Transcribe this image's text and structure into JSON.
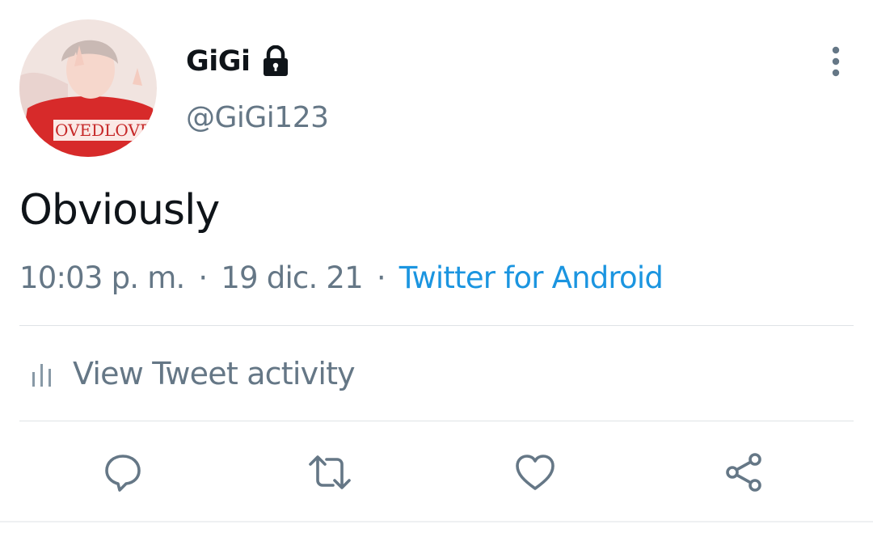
{
  "user": {
    "display_name": "GiGi",
    "handle": "@GiGi123",
    "avatar_shirt_text": "OVEDLOVE"
  },
  "tweet": {
    "text": "Obviously",
    "time": "10:03 p. m.",
    "date": "19 dic. 21",
    "separator": "·",
    "source": "Twitter for Android"
  },
  "activity": {
    "label": "View Tweet activity"
  },
  "icons": {
    "lock": "lock-icon",
    "more": "more-vertical-icon",
    "activity": "bar-chart-icon",
    "reply": "reply-icon",
    "retweet": "retweet-icon",
    "like": "heart-icon",
    "share": "share-icon"
  },
  "colors": {
    "text_primary": "#0f1419",
    "text_secondary": "#657786",
    "link": "#1b95e0",
    "icon": "#657786",
    "avatar_red": "#d72a2a"
  }
}
